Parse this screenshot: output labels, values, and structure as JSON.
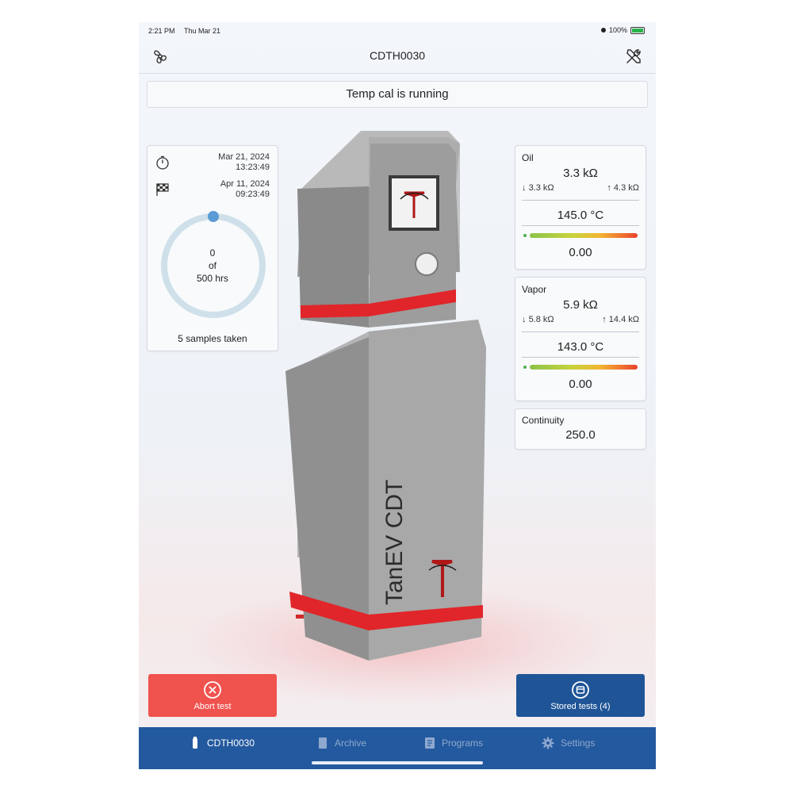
{
  "statusbar": {
    "time": "2:21 PM",
    "day": "Thu Mar 21",
    "battery": "100%"
  },
  "nav": {
    "title": "CDTH0030",
    "left_icon": "fan-icon",
    "right_icon": "tools-icon"
  },
  "banner": {
    "text": "Temp cal is running"
  },
  "progress_card": {
    "start_date": "Mar 21, 2024",
    "start_time": "13:23:49",
    "end_date": "Apr 11, 2024",
    "end_time": "09:23:49",
    "ring_value": "0",
    "ring_of": "of",
    "ring_total": "500 hrs",
    "progress_fraction": 0,
    "samples": "5 samples taken"
  },
  "oil": {
    "title": "Oil",
    "resistance": "3.3 kΩ",
    "min": "3.3 kΩ",
    "max": "4.3 kΩ",
    "temp": "145.0 °C",
    "value": "0.00"
  },
  "vapor": {
    "title": "Vapor",
    "resistance": "5.9 kΩ",
    "min": "5.8 kΩ",
    "max": "14.4 kΩ",
    "temp": "143.0 °C",
    "value": "0.00"
  },
  "continuity": {
    "title": "Continuity",
    "value": "250.0"
  },
  "machine": {
    "brand_text": "TanEV CDT"
  },
  "buttons": {
    "abort": "Abort test",
    "stored": "Stored tests (4)"
  },
  "tabs": [
    {
      "label": "CDTH0030",
      "icon": "device-icon"
    },
    {
      "label": "Archive",
      "icon": "archive-icon"
    },
    {
      "label": "Programs",
      "icon": "programs-icon"
    },
    {
      "label": "Settings",
      "icon": "gear-icon"
    }
  ],
  "colors": {
    "accent": "#23599e",
    "danger": "#f0524e",
    "stripe": "#e0262a"
  }
}
